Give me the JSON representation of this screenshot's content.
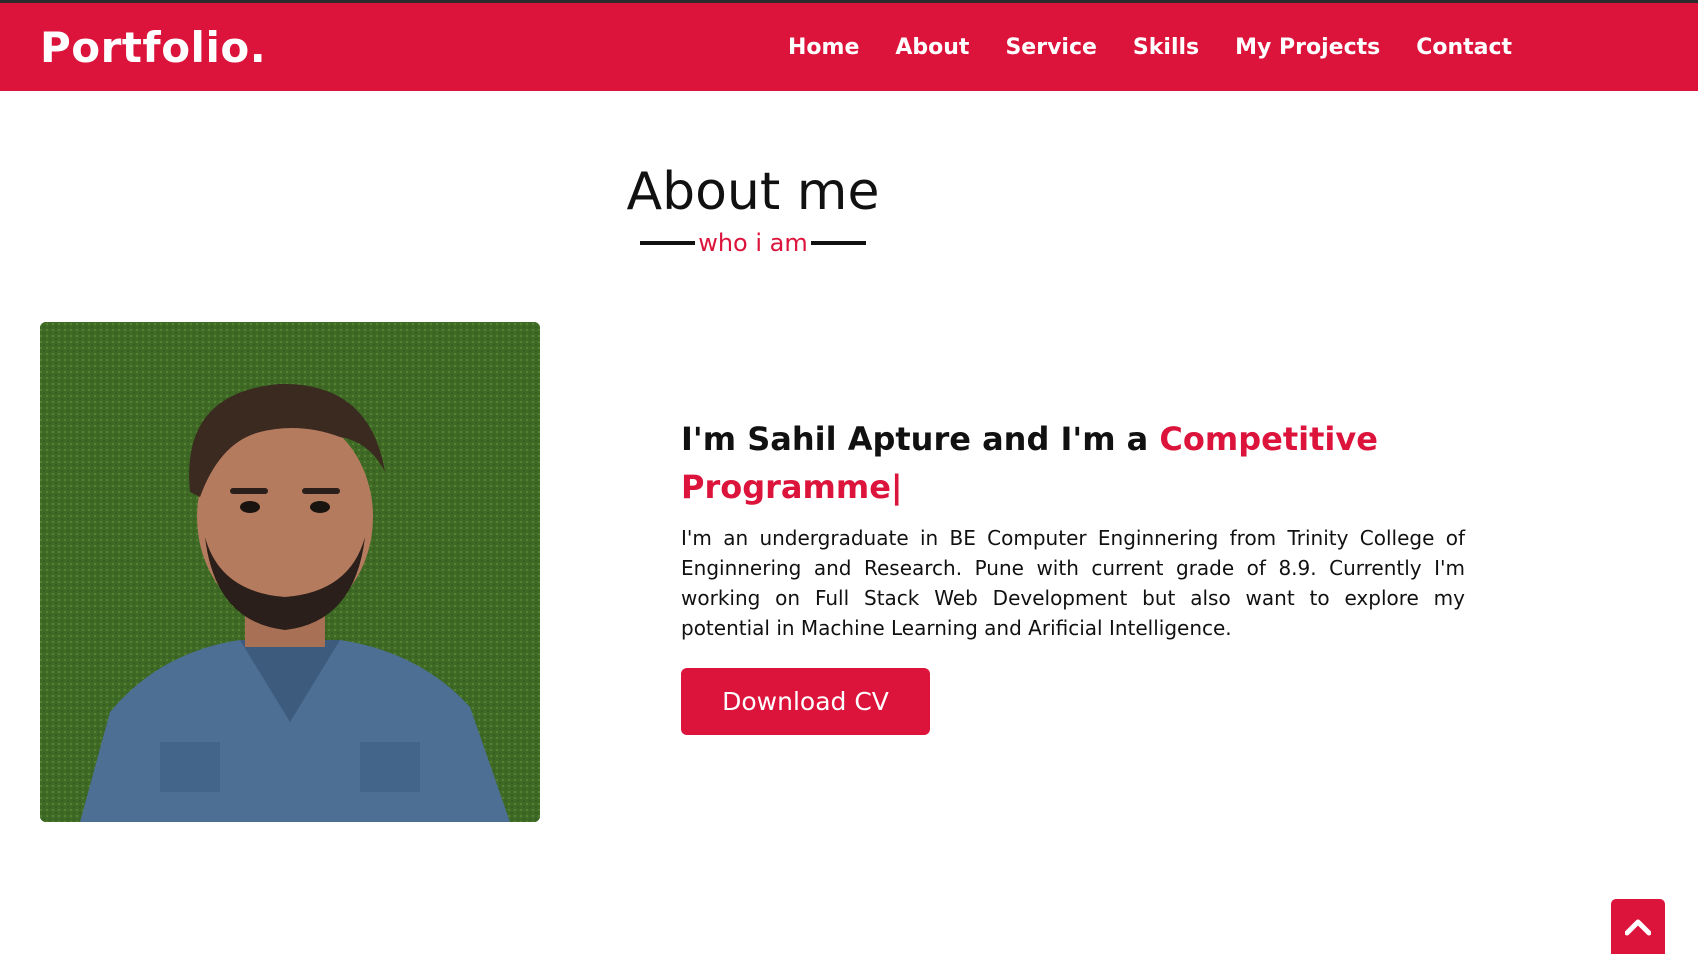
{
  "brand": {
    "logo": "Portfolio.",
    "accent": "#dc143c"
  },
  "nav": {
    "items": [
      {
        "label": "Home"
      },
      {
        "label": "About"
      },
      {
        "label": "Service"
      },
      {
        "label": "Skills"
      },
      {
        "label": "My Projects"
      },
      {
        "label": "Contact"
      }
    ]
  },
  "about": {
    "title": "About me",
    "subtitle": "who i am",
    "headline_prefix": "I'm Sahil Apture and I'm a ",
    "headline_role": "Competitive Programme|",
    "bio": "I'm an undergraduate in BE Computer Enginnering from Trinity College of Enginnering and Research. Pune with current grade of 8.9. Currently I'm working on Full Stack Web Development but also want to explore my potential in Machine Learning and Arificial Intelligence.",
    "cv_button": "Download CV"
  },
  "icons": {
    "scroll_top": "chevron-up-icon"
  }
}
